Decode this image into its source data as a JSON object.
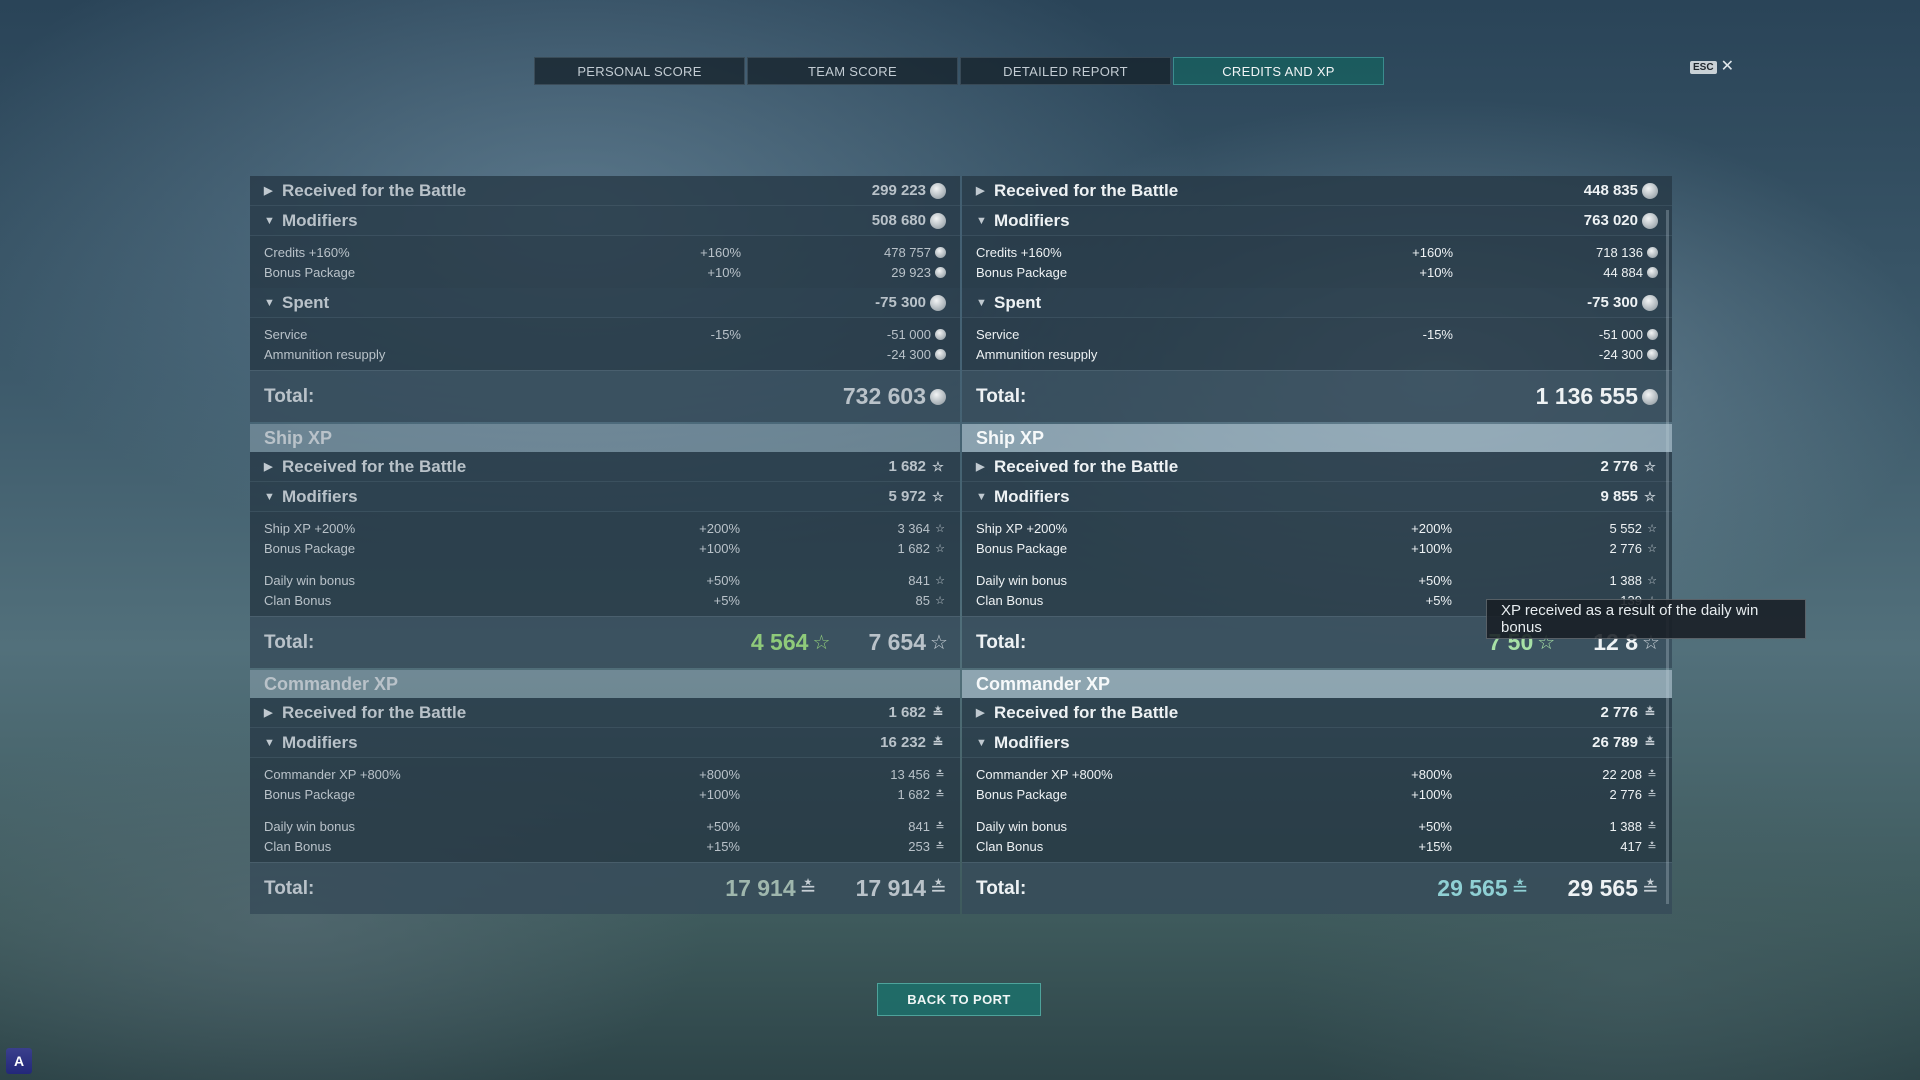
{
  "tabs": [
    "PERSONAL SCORE",
    "TEAM SCORE",
    "DETAILED REPORT",
    "CREDITS AND XP"
  ],
  "esc": {
    "key": "ESC",
    "close": "✕"
  },
  "left": {
    "credits": {
      "received": {
        "label": "Received for the Battle",
        "value": "299 223"
      },
      "modifiers": {
        "label": "Modifiers",
        "value": "508 680",
        "items": [
          {
            "label": "Credits +160%",
            "pct": "+160%",
            "value": "478 757"
          },
          {
            "label": "Bonus Package",
            "pct": "+10%",
            "value": "29 923"
          }
        ]
      },
      "spent": {
        "label": "Spent",
        "value": "-75 300",
        "items": [
          {
            "label": "Service",
            "pct": "-15%",
            "value": "-51 000"
          },
          {
            "label": "Ammunition resupply",
            "pct": "",
            "value": "-24 300"
          }
        ]
      },
      "total": {
        "label": "Total:",
        "value": "732 603"
      }
    },
    "ship_xp": {
      "title": "Ship XP",
      "received": {
        "label": "Received for the Battle",
        "value": "1 682"
      },
      "modifiers": {
        "label": "Modifiers",
        "value": "5 972",
        "items": [
          {
            "label": "Ship XP +200%",
            "pct": "+200%",
            "value": "3 364"
          },
          {
            "label": "Bonus Package",
            "pct": "+100%",
            "value": "1 682"
          },
          {
            "label": "Daily win bonus",
            "pct": "+50%",
            "value": "841"
          },
          {
            "label": "Clan Bonus",
            "pct": "+5%",
            "value": "85"
          }
        ]
      },
      "total": {
        "label": "Total:",
        "value_green": "4 564",
        "value": "7 654"
      }
    },
    "commander_xp": {
      "title": "Commander XP",
      "received": {
        "label": "Received for the Battle",
        "value": "1 682"
      },
      "modifiers": {
        "label": "Modifiers",
        "value": "16 232",
        "items": [
          {
            "label": "Commander XP +800%",
            "pct": "+800%",
            "value": "13 456"
          },
          {
            "label": "Bonus Package",
            "pct": "+100%",
            "value": "1 682"
          },
          {
            "label": "Daily win bonus",
            "pct": "+50%",
            "value": "841"
          },
          {
            "label": "Clan Bonus",
            "pct": "+15%",
            "value": "253"
          }
        ]
      },
      "total": {
        "label": "Total:",
        "value_green": "17 914",
        "value": "17 914"
      }
    }
  },
  "right": {
    "credits": {
      "received": {
        "label": "Received for the Battle",
        "value": "448 835"
      },
      "modifiers": {
        "label": "Modifiers",
        "value": "763 020",
        "items": [
          {
            "label": "Credits +160%",
            "pct": "+160%",
            "value": "718 136"
          },
          {
            "label": "Bonus Package",
            "pct": "+10%",
            "value": "44 884"
          }
        ]
      },
      "spent": {
        "label": "Spent",
        "value": "-75 300",
        "items": [
          {
            "label": "Service",
            "pct": "-15%",
            "value": "-51 000"
          },
          {
            "label": "Ammunition resupply",
            "pct": "",
            "value": "-24 300"
          }
        ]
      },
      "total": {
        "label": "Total:",
        "value": "1 136 555"
      }
    },
    "ship_xp": {
      "title": "Ship XP",
      "received": {
        "label": "Received for the Battle",
        "value": "2 776"
      },
      "modifiers": {
        "label": "Modifiers",
        "value": "9 855",
        "items": [
          {
            "label": "Ship XP +200%",
            "pct": "+200%",
            "value": "5 552"
          },
          {
            "label": "Bonus Package",
            "pct": "+100%",
            "value": "2 776"
          },
          {
            "label": "Daily win bonus",
            "pct": "+50%",
            "value": "1 388"
          },
          {
            "label": "Clan Bonus",
            "pct": "+5%",
            "value": "139"
          }
        ]
      },
      "total": {
        "label": "Total:",
        "value_green": "7 50",
        "value": "12 8"
      }
    },
    "commander_xp": {
      "title": "Commander XP",
      "received": {
        "label": "Received for the Battle",
        "value": "2 776"
      },
      "modifiers": {
        "label": "Modifiers",
        "value": "26 789",
        "items": [
          {
            "label": "Commander XP +800%",
            "pct": "+800%",
            "value": "22 208"
          },
          {
            "label": "Bonus Package",
            "pct": "+100%",
            "value": "2 776"
          },
          {
            "label": "Daily win bonus",
            "pct": "+50%",
            "value": "1 388"
          },
          {
            "label": "Clan Bonus",
            "pct": "+15%",
            "value": "417"
          }
        ]
      },
      "total": {
        "label": "Total:",
        "value_green": "29 565",
        "value": "29 565"
      }
    }
  },
  "tooltip": "XP received as a result of the daily win bonus",
  "back_button": "BACK TO PORT",
  "icons": {
    "credits": "credits-icon",
    "xp": "star-icon",
    "commander_xp": "commander-xp-icon"
  }
}
